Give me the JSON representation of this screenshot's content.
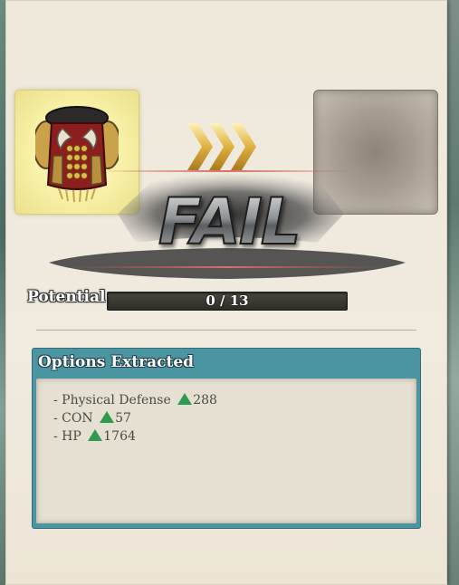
{
  "result": {
    "status_text": "FAIL"
  },
  "potential": {
    "label": "Potential",
    "current": 0,
    "max": 13,
    "display": "0 / 13"
  },
  "options": {
    "title": "Options Extracted",
    "items": [
      {
        "prefix": "- Physical Defense",
        "icon": "green-up-arrow-icon",
        "value": "288"
      },
      {
        "prefix": "- CON",
        "icon": "green-up-arrow-icon",
        "value": "57"
      },
      {
        "prefix": "- HP",
        "icon": "green-up-arrow-icon",
        "value": "1764"
      }
    ]
  },
  "slots": {
    "source_icon": "armor-chest-icon",
    "target_icon": "empty-slot"
  },
  "colors": {
    "options_header": "#4b95a3",
    "increase_arrow": "#2e9a52",
    "source_slot_glow": "#f7f0a6",
    "arrow_gold": "#e0b040"
  }
}
